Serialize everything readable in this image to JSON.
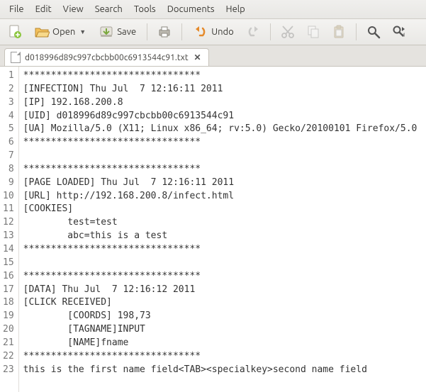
{
  "menubar": {
    "items": [
      "File",
      "Edit",
      "View",
      "Search",
      "Tools",
      "Documents",
      "Help"
    ]
  },
  "toolbar": {
    "open_label": "Open",
    "save_label": "Save",
    "undo_label": "Undo"
  },
  "tab": {
    "filename": "d018996d89c997cbcbb00c6913544c91.txt",
    "close_glyph": "✕"
  },
  "editor": {
    "lines": [
      "********************************",
      "[INFECTION] Thu Jul  7 12:16:11 2011",
      "[IP] 192.168.200.8",
      "[UID] d018996d89c997cbcbb00c6913544c91",
      "[UA] Mozilla/5.0 (X11; Linux x86_64; rv:5.0) Gecko/20100101 Firefox/5.0",
      "********************************",
      "",
      "********************************",
      "[PAGE LOADED] Thu Jul  7 12:16:11 2011",
      "[URL] http://192.168.200.8/infect.html",
      "[COOKIES]",
      "        test=test",
      "        abc=this is a test",
      "********************************",
      "",
      "********************************",
      "[DATA] Thu Jul  7 12:16:12 2011",
      "[CLICK RECEIVED]",
      "        [COORDS] 198,73",
      "        [TAGNAME]INPUT",
      "        [NAME]fname",
      "********************************",
      "this is the first name field<TAB><specialkey>second name field"
    ]
  }
}
